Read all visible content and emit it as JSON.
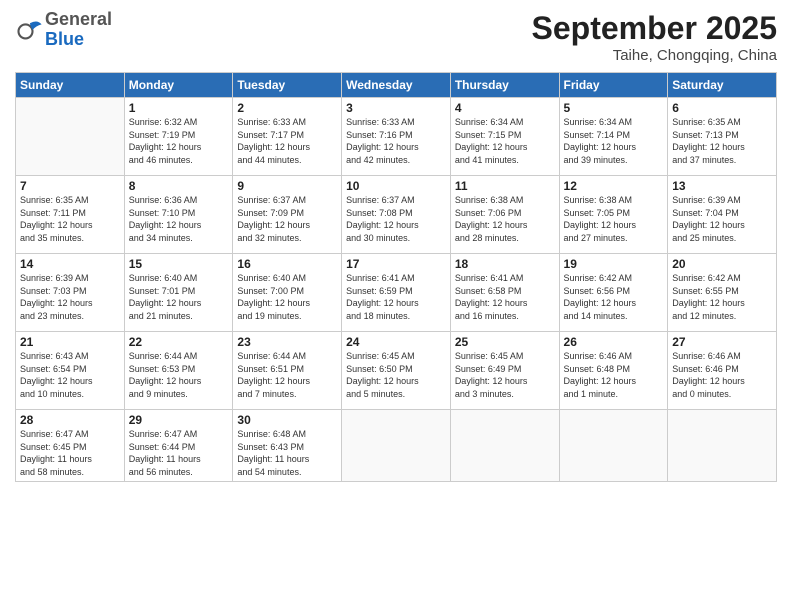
{
  "header": {
    "logo_general": "General",
    "logo_blue": "Blue",
    "month": "September 2025",
    "location": "Taihe, Chongqing, China"
  },
  "weekdays": [
    "Sunday",
    "Monday",
    "Tuesday",
    "Wednesday",
    "Thursday",
    "Friday",
    "Saturday"
  ],
  "days": [
    {
      "num": "",
      "info": ""
    },
    {
      "num": "1",
      "info": "Sunrise: 6:32 AM\nSunset: 7:19 PM\nDaylight: 12 hours\nand 46 minutes."
    },
    {
      "num": "2",
      "info": "Sunrise: 6:33 AM\nSunset: 7:17 PM\nDaylight: 12 hours\nand 44 minutes."
    },
    {
      "num": "3",
      "info": "Sunrise: 6:33 AM\nSunset: 7:16 PM\nDaylight: 12 hours\nand 42 minutes."
    },
    {
      "num": "4",
      "info": "Sunrise: 6:34 AM\nSunset: 7:15 PM\nDaylight: 12 hours\nand 41 minutes."
    },
    {
      "num": "5",
      "info": "Sunrise: 6:34 AM\nSunset: 7:14 PM\nDaylight: 12 hours\nand 39 minutes."
    },
    {
      "num": "6",
      "info": "Sunrise: 6:35 AM\nSunset: 7:13 PM\nDaylight: 12 hours\nand 37 minutes."
    },
    {
      "num": "7",
      "info": "Sunrise: 6:35 AM\nSunset: 7:11 PM\nDaylight: 12 hours\nand 35 minutes."
    },
    {
      "num": "8",
      "info": "Sunrise: 6:36 AM\nSunset: 7:10 PM\nDaylight: 12 hours\nand 34 minutes."
    },
    {
      "num": "9",
      "info": "Sunrise: 6:37 AM\nSunset: 7:09 PM\nDaylight: 12 hours\nand 32 minutes."
    },
    {
      "num": "10",
      "info": "Sunrise: 6:37 AM\nSunset: 7:08 PM\nDaylight: 12 hours\nand 30 minutes."
    },
    {
      "num": "11",
      "info": "Sunrise: 6:38 AM\nSunset: 7:06 PM\nDaylight: 12 hours\nand 28 minutes."
    },
    {
      "num": "12",
      "info": "Sunrise: 6:38 AM\nSunset: 7:05 PM\nDaylight: 12 hours\nand 27 minutes."
    },
    {
      "num": "13",
      "info": "Sunrise: 6:39 AM\nSunset: 7:04 PM\nDaylight: 12 hours\nand 25 minutes."
    },
    {
      "num": "14",
      "info": "Sunrise: 6:39 AM\nSunset: 7:03 PM\nDaylight: 12 hours\nand 23 minutes."
    },
    {
      "num": "15",
      "info": "Sunrise: 6:40 AM\nSunset: 7:01 PM\nDaylight: 12 hours\nand 21 minutes."
    },
    {
      "num": "16",
      "info": "Sunrise: 6:40 AM\nSunset: 7:00 PM\nDaylight: 12 hours\nand 19 minutes."
    },
    {
      "num": "17",
      "info": "Sunrise: 6:41 AM\nSunset: 6:59 PM\nDaylight: 12 hours\nand 18 minutes."
    },
    {
      "num": "18",
      "info": "Sunrise: 6:41 AM\nSunset: 6:58 PM\nDaylight: 12 hours\nand 16 minutes."
    },
    {
      "num": "19",
      "info": "Sunrise: 6:42 AM\nSunset: 6:56 PM\nDaylight: 12 hours\nand 14 minutes."
    },
    {
      "num": "20",
      "info": "Sunrise: 6:42 AM\nSunset: 6:55 PM\nDaylight: 12 hours\nand 12 minutes."
    },
    {
      "num": "21",
      "info": "Sunrise: 6:43 AM\nSunset: 6:54 PM\nDaylight: 12 hours\nand 10 minutes."
    },
    {
      "num": "22",
      "info": "Sunrise: 6:44 AM\nSunset: 6:53 PM\nDaylight: 12 hours\nand 9 minutes."
    },
    {
      "num": "23",
      "info": "Sunrise: 6:44 AM\nSunset: 6:51 PM\nDaylight: 12 hours\nand 7 minutes."
    },
    {
      "num": "24",
      "info": "Sunrise: 6:45 AM\nSunset: 6:50 PM\nDaylight: 12 hours\nand 5 minutes."
    },
    {
      "num": "25",
      "info": "Sunrise: 6:45 AM\nSunset: 6:49 PM\nDaylight: 12 hours\nand 3 minutes."
    },
    {
      "num": "26",
      "info": "Sunrise: 6:46 AM\nSunset: 6:48 PM\nDaylight: 12 hours\nand 1 minute."
    },
    {
      "num": "27",
      "info": "Sunrise: 6:46 AM\nSunset: 6:46 PM\nDaylight: 12 hours\nand 0 minutes."
    },
    {
      "num": "28",
      "info": "Sunrise: 6:47 AM\nSunset: 6:45 PM\nDaylight: 11 hours\nand 58 minutes."
    },
    {
      "num": "29",
      "info": "Sunrise: 6:47 AM\nSunset: 6:44 PM\nDaylight: 11 hours\nand 56 minutes."
    },
    {
      "num": "30",
      "info": "Sunrise: 6:48 AM\nSunset: 6:43 PM\nDaylight: 11 hours\nand 54 minutes."
    },
    {
      "num": "",
      "info": ""
    },
    {
      "num": "",
      "info": ""
    },
    {
      "num": "",
      "info": ""
    },
    {
      "num": "",
      "info": ""
    }
  ]
}
